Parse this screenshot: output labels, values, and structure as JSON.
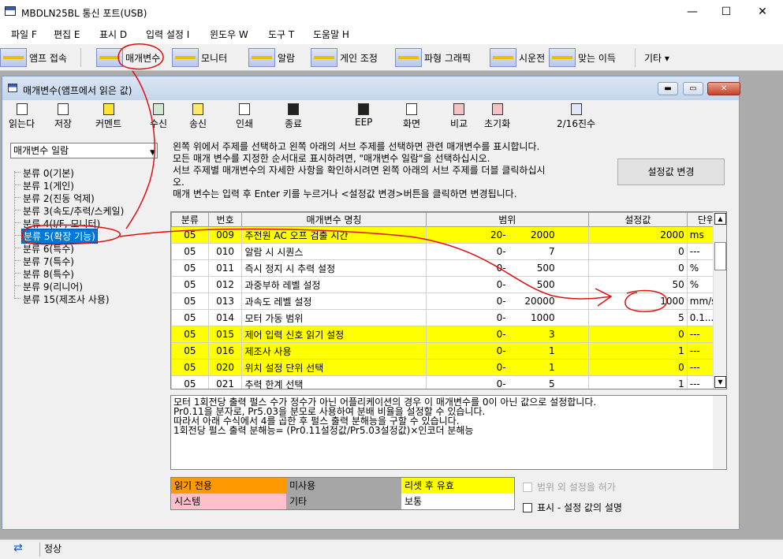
{
  "app": {
    "title": "MBDLN25BL 통신 포트(USB)",
    "minimize": "—",
    "maximize": "☐",
    "close": "✕"
  },
  "menu": [
    "파일 F",
    "편집 E",
    "표시 D",
    "입력 설정 I",
    "윈도우 W",
    "도구 T",
    "도움말 H"
  ],
  "toolbar": {
    "items": [
      "앰프 접속",
      "매개변수",
      "모니터",
      "알람",
      "게인 조정",
      "파형 그래픽",
      "시운전",
      "맞는 이득",
      "기타 ▾"
    ]
  },
  "child": {
    "title": "매개변수(앰프에서 읽은 값)"
  },
  "icon_buttons": [
    "읽는다",
    "저장",
    "커멘트",
    "수신",
    "송신",
    "인쇄",
    "종료",
    "EEP",
    "화면",
    "비교",
    "초기화",
    "2/16진수"
  ],
  "dropdown": {
    "value": "매개변수 일람"
  },
  "tree": [
    "분류 0(기본)",
    "분류 1(게인)",
    "분류 2(진동 억제)",
    "분류 3(속도/추력/스케일)",
    "분류 4(I/F, 모니터)",
    "분류 5(확장 기능)",
    "분류 6(특수)",
    "분류 7(특수)",
    "분류 8(특수)",
    "분류 9(리니어)",
    "분류 15(제조사 사용)"
  ],
  "description": [
    "왼쪽 위에서 주제를 선택하고 왼쪽 아래의 서브 주제를 선택하면 관련 매개변수를 표시합니다.",
    "모든 매개 변수를 지정한 순서대로 표시하려면, \"매개변수 일람\"을 선택하십시오.",
    "서브 주제별 매개변수의 자세한 사항을 확인하시려면 왼쪽 아래의 서브 주제를 더블 클릭하십시",
    "오.",
    "매개 변수는 입력 후 Enter 키를 누르거나 <설정값 변경>버튼을 클릭하면 변경됩니다."
  ],
  "change_button": "설정값 변경",
  "grid": {
    "headers": [
      "분류",
      "번호",
      "매개변수 명칭",
      "범위",
      "설정값",
      "단위"
    ],
    "rows": [
      {
        "cls": "05",
        "no": "009",
        "name": "주전원 AC 오프 검출 시간",
        "min": "20-",
        "max": "2000",
        "value": "2000",
        "unit": "ms",
        "hl": true
      },
      {
        "cls": "05",
        "no": "010",
        "name": "알람 시 시퀀스",
        "min": "0-",
        "max": "7",
        "value": "0",
        "unit": "---",
        "hl": false
      },
      {
        "cls": "05",
        "no": "011",
        "name": "즉시 정지 시 추력 설정",
        "min": "0-",
        "max": "500",
        "value": "0",
        "unit": "%",
        "hl": false
      },
      {
        "cls": "05",
        "no": "012",
        "name": "과중부하 레벨 설정",
        "min": "0-",
        "max": "500",
        "value": "50",
        "unit": "%",
        "hl": false
      },
      {
        "cls": "05",
        "no": "013",
        "name": "과속도 레벨 설정",
        "min": "0-",
        "max": "20000",
        "value": "1000",
        "unit": "mm/s",
        "hl": false
      },
      {
        "cls": "05",
        "no": "014",
        "name": "모터 가동 범위",
        "min": "0-",
        "max": "1000",
        "value": "5",
        "unit": "0.1...",
        "hl": false
      },
      {
        "cls": "05",
        "no": "015",
        "name": "제어 입력 신호 읽기 설정",
        "min": "0-",
        "max": "3",
        "value": "0",
        "unit": "---",
        "hl": true
      },
      {
        "cls": "05",
        "no": "016",
        "name": "제조사 사용",
        "min": "0-",
        "max": "1",
        "value": "1",
        "unit": "---",
        "hl": true
      },
      {
        "cls": "05",
        "no": "020",
        "name": "위치 설정 단위 선택",
        "min": "0-",
        "max": "1",
        "value": "0",
        "unit": "---",
        "hl": true
      },
      {
        "cls": "05",
        "no": "021",
        "name": "추력 한계 선택",
        "min": "0-",
        "max": "5",
        "value": "1",
        "unit": "---",
        "hl": false
      }
    ]
  },
  "info": [
    "모터 1회전당 출력 펄스 수가 정수가 아닌 어플리케이션의 경우 이 매개변수를 0이 아닌 값으로 설정합니다.",
    "Pr0.11을 분자로, Pr5.03을 분모로 사용하여 분배 비율을 설정할 수 있습니다.",
    "따라서 아래 수식에서 4를 곱한 후 펄스 출력 분해능을 구할 수 있습니다.",
    "1회전당 펄스 출력 분해능= (Pr0.11설정값/Pr5.03설정값)×인코더 분해능"
  ],
  "legend": [
    {
      "label": "읽기 전용",
      "color": "#ff9900"
    },
    {
      "label": "미사용",
      "color": "#a6a6a6"
    },
    {
      "label": "리셋 후 유효",
      "color": "#ffff00"
    },
    {
      "label": "시스템",
      "color": "#ffc0cb"
    },
    {
      "label": "기타",
      "color": "#a6a6a6"
    },
    {
      "label": "보통",
      "color": "#ffffff"
    }
  ],
  "checks": [
    "범위 외 설정을 허가",
    "표시 - 설정 값의 설명"
  ],
  "status": {
    "icon": "sync-arrows-icon",
    "text": "정상"
  }
}
